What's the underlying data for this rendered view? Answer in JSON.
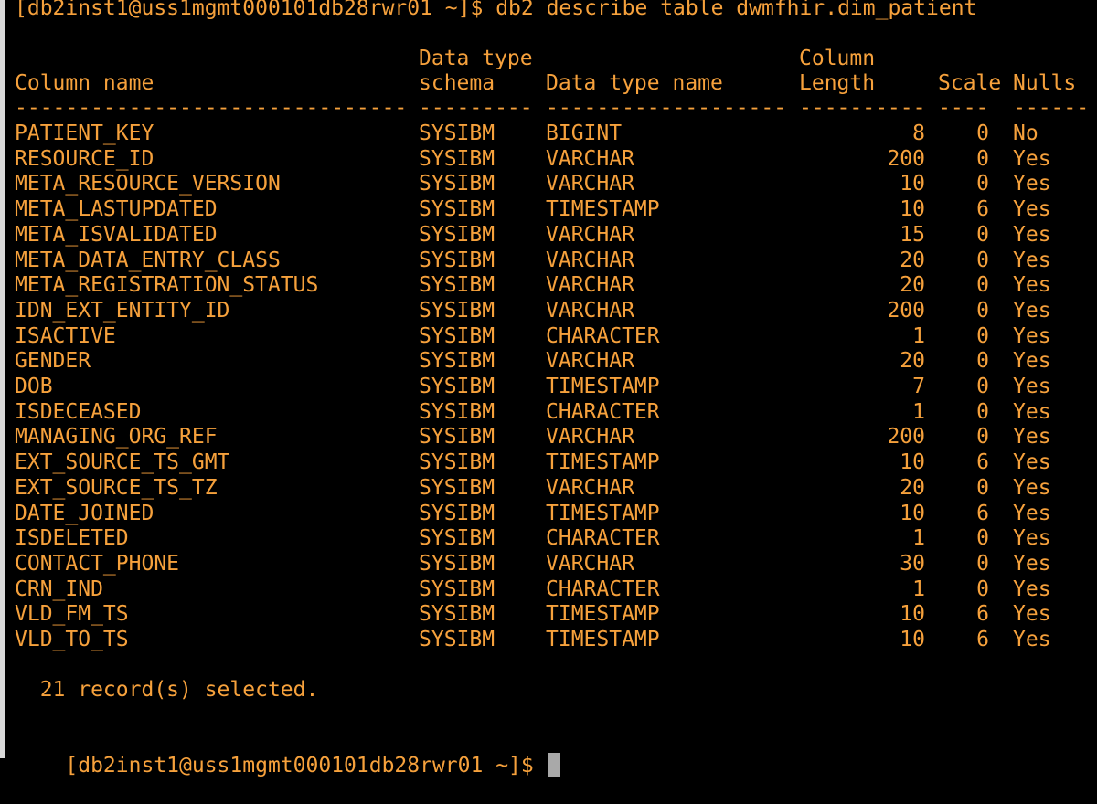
{
  "terminal": {
    "command_line": "[db2inst1@uss1mgmt000101db28rwr01 ~]$ db2 describe table dwmfhir.dim_patient",
    "headers": {
      "row1": {
        "schema": "Data type",
        "length": "Column"
      },
      "row2": {
        "name": "Column name",
        "schema": "schema",
        "type": "Data type name",
        "length": "Length",
        "scale": "Scale",
        "nulls": "Nulls"
      }
    },
    "separator": {
      "name": "-------------------------------",
      "schema": "---------",
      "type": "-------------------",
      "length": "----------",
      "scale": "-----",
      "nulls": "------"
    },
    "rows": [
      {
        "name": "PATIENT_KEY",
        "schema": "SYSIBM",
        "type": "BIGINT",
        "length": "8",
        "scale": "0",
        "nulls": "No"
      },
      {
        "name": "RESOURCE_ID",
        "schema": "SYSIBM",
        "type": "VARCHAR",
        "length": "200",
        "scale": "0",
        "nulls": "Yes"
      },
      {
        "name": "META_RESOURCE_VERSION",
        "schema": "SYSIBM",
        "type": "VARCHAR",
        "length": "10",
        "scale": "0",
        "nulls": "Yes"
      },
      {
        "name": "META_LASTUPDATED",
        "schema": "SYSIBM",
        "type": "TIMESTAMP",
        "length": "10",
        "scale": "6",
        "nulls": "Yes"
      },
      {
        "name": "META_ISVALIDATED",
        "schema": "SYSIBM",
        "type": "VARCHAR",
        "length": "15",
        "scale": "0",
        "nulls": "Yes"
      },
      {
        "name": "META_DATA_ENTRY_CLASS",
        "schema": "SYSIBM",
        "type": "VARCHAR",
        "length": "20",
        "scale": "0",
        "nulls": "Yes"
      },
      {
        "name": "META_REGISTRATION_STATUS",
        "schema": "SYSIBM",
        "type": "VARCHAR",
        "length": "20",
        "scale": "0",
        "nulls": "Yes"
      },
      {
        "name": "IDN_EXT_ENTITY_ID",
        "schema": "SYSIBM",
        "type": "VARCHAR",
        "length": "200",
        "scale": "0",
        "nulls": "Yes"
      },
      {
        "name": "ISACTIVE",
        "schema": "SYSIBM",
        "type": "CHARACTER",
        "length": "1",
        "scale": "0",
        "nulls": "Yes"
      },
      {
        "name": "GENDER",
        "schema": "SYSIBM",
        "type": "VARCHAR",
        "length": "20",
        "scale": "0",
        "nulls": "Yes"
      },
      {
        "name": "DOB",
        "schema": "SYSIBM",
        "type": "TIMESTAMP",
        "length": "7",
        "scale": "0",
        "nulls": "Yes"
      },
      {
        "name": "ISDECEASED",
        "schema": "SYSIBM",
        "type": "CHARACTER",
        "length": "1",
        "scale": "0",
        "nulls": "Yes"
      },
      {
        "name": "MANAGING_ORG_REF",
        "schema": "SYSIBM",
        "type": "VARCHAR",
        "length": "200",
        "scale": "0",
        "nulls": "Yes"
      },
      {
        "name": "EXT_SOURCE_TS_GMT",
        "schema": "SYSIBM",
        "type": "TIMESTAMP",
        "length": "10",
        "scale": "6",
        "nulls": "Yes"
      },
      {
        "name": "EXT_SOURCE_TS_TZ",
        "schema": "SYSIBM",
        "type": "VARCHAR",
        "length": "20",
        "scale": "0",
        "nulls": "Yes"
      },
      {
        "name": "DATE_JOINED",
        "schema": "SYSIBM",
        "type": "TIMESTAMP",
        "length": "10",
        "scale": "6",
        "nulls": "Yes"
      },
      {
        "name": "ISDELETED",
        "schema": "SYSIBM",
        "type": "CHARACTER",
        "length": "1",
        "scale": "0",
        "nulls": "Yes"
      },
      {
        "name": "CONTACT_PHONE",
        "schema": "SYSIBM",
        "type": "VARCHAR",
        "length": "30",
        "scale": "0",
        "nulls": "Yes"
      },
      {
        "name": "CRN_IND",
        "schema": "SYSIBM",
        "type": "CHARACTER",
        "length": "1",
        "scale": "0",
        "nulls": "Yes"
      },
      {
        "name": "VLD_FM_TS",
        "schema": "SYSIBM",
        "type": "TIMESTAMP",
        "length": "10",
        "scale": "6",
        "nulls": "Yes"
      },
      {
        "name": "VLD_TO_TS",
        "schema": "SYSIBM",
        "type": "TIMESTAMP",
        "length": "10",
        "scale": "6",
        "nulls": "Yes"
      }
    ],
    "summary": "  21 record(s) selected.",
    "prompt": "[db2inst1@uss1mgmt000101db28rwr01 ~]$ "
  },
  "colors": {
    "background": "#000000",
    "text": "#f6a13c",
    "cursor": "#a9a9a9"
  }
}
